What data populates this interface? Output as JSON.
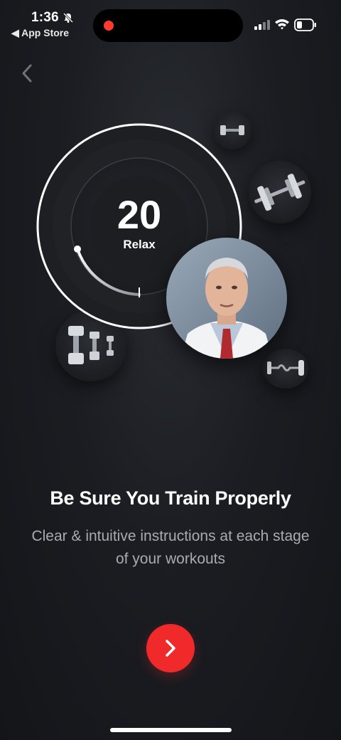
{
  "status_bar": {
    "time": "1:36",
    "back_app": "◀ App Store"
  },
  "timer": {
    "value": "20",
    "label": "Relax",
    "progress": 0.2
  },
  "onboarding": {
    "headline": "Be Sure You Train Properly",
    "subtitle": "Clear & intuitive instructions at each stage of your workouts"
  },
  "colors": {
    "accent": "#f02a2a",
    "background": "#1b1d22",
    "subtitle": "#a9abb0"
  },
  "icons": {
    "back": "chevron-left-icon",
    "next": "chevron-right-icon"
  }
}
